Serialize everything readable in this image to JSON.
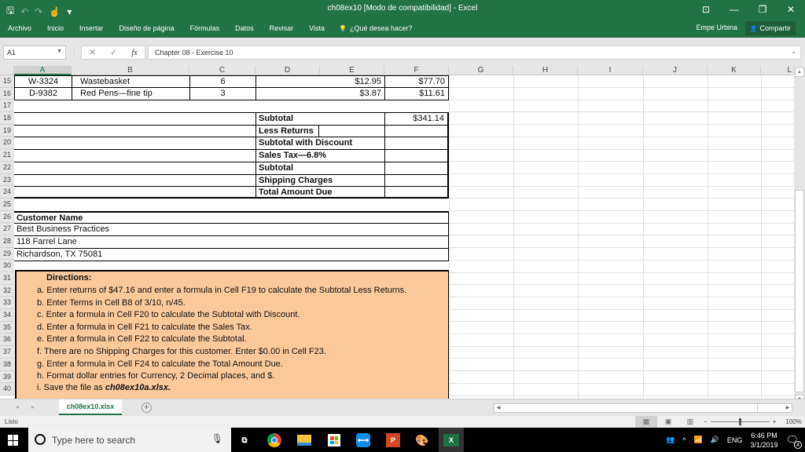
{
  "window": {
    "title": "ch08ex10  [Modo de compatibilidad] - Excel",
    "controls": {
      "ribbon_display": "⊡",
      "minimize": "—",
      "restore": "❐",
      "close": "✕"
    }
  },
  "quick_access": {
    "save": "🖫",
    "undo": "↶",
    "redo": "↷",
    "touch": "☝",
    "customize": "▾"
  },
  "ribbon": {
    "tabs": [
      "Archivo",
      "Inicio",
      "Insertar",
      "Diseño de página",
      "Fórmulas",
      "Datos",
      "Revisar",
      "Vista"
    ],
    "tell_me_icon": "💡",
    "tell_me": "¿Qué desea hacer?",
    "user": "Empe Urbina",
    "share_icon": "👤",
    "share": "Compartir"
  },
  "formula_bar": {
    "name_box": "A1",
    "cancel": "✕",
    "enter": "✓",
    "fx": "fx",
    "content": "Chapter 08 - Exercise 10"
  },
  "columns": [
    "A",
    "B",
    "C",
    "D",
    "E",
    "F",
    "G",
    "H",
    "I",
    "J",
    "K",
    "L"
  ],
  "rows": [
    "15",
    "16",
    "17",
    "18",
    "19",
    "20",
    "21",
    "22",
    "23",
    "24",
    "25",
    "26",
    "27",
    "28",
    "29",
    "30",
    "31",
    "32",
    "33",
    "34",
    "35",
    "36",
    "37",
    "38",
    "39",
    "40"
  ],
  "items": [
    {
      "code": "W-3324",
      "description": "Wastebasket",
      "qty": "6",
      "price": "$12.95",
      "total": "$77.70"
    },
    {
      "code": "D-9382",
      "description": "Red Pens—fine tip",
      "qty": "3",
      "price": "$3.87",
      "total": "$11.61"
    }
  ],
  "summary": [
    {
      "label": "Subtotal",
      "value": "$341.14"
    },
    {
      "label": "Less Returns",
      "value": ""
    },
    {
      "label": "Subtotal with Discount",
      "value": ""
    },
    {
      "label": "Sales Tax—6.8%",
      "value": ""
    },
    {
      "label": "Subtotal",
      "value": ""
    },
    {
      "label": "Shipping Charges",
      "value": ""
    },
    {
      "label": "Total Amount Due",
      "value": ""
    }
  ],
  "customer": {
    "heading": "Customer Name",
    "name": "Best Business Practices",
    "address": "118 Farrel Lane",
    "city": "Richardson, TX 75081"
  },
  "directions": {
    "heading": "Directions:",
    "steps": [
      "a.  Enter returns of $47.16 and enter a formula in Cell F19 to calculate the Subtotal Less Returns.",
      "b.  Enter Terms in Cell B8 of 3/10, n/45.",
      "c.  Enter a formula in Cell F20 to calculate the Subtotal with Discount.",
      "d.  Enter a formula in Cell F21 to calculate the Sales Tax.",
      "e.  Enter a formula in Cell F22 to calculate the Subtotal.",
      "f.  There are no Shipping Charges for this customer. Enter $0.00 in Cell F23.",
      "g.  Enter a formula in Cell F24 to calculate the Total Amount Due.",
      "h.  Format dollar entries for Currency, 2 Decimal places, and $."
    ],
    "last_step_prefix": "i.  Save the file as ",
    "last_step_file": "ch08ex10a.xlsx."
  },
  "sheet_tabs": {
    "active": "ch08ex10.xlsx",
    "add": "+",
    "prev": "◂",
    "next": "▸"
  },
  "status": {
    "ready": "Listo",
    "zoom_minus": "−",
    "zoom_plus": "+",
    "zoom": "100%",
    "zoom_level_percent": 100
  },
  "taskbar": {
    "search_placeholder": "Type here to search",
    "apps": [
      "task-view",
      "chrome",
      "file-explorer",
      "store",
      "teamviewer",
      "powerpoint",
      "paint",
      "excel"
    ],
    "language": "ENG",
    "time": "6:46 PM",
    "date": "3/1/2019",
    "notifications": "4"
  },
  "colors": {
    "excel_green": "#217346",
    "directions_fill": "#fcc99b"
  }
}
